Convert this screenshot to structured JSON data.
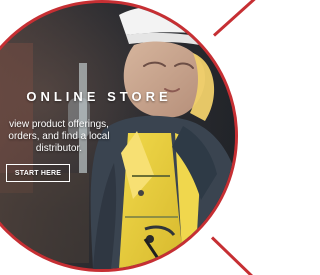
{
  "promo": {
    "title": "ONLINE STORE",
    "description": "view product offerings, orders, and find a local distributor.",
    "button_label": "START HERE"
  },
  "colors": {
    "accent_red": "#c62f33",
    "text_white": "#ffffff"
  },
  "icons": {
    "hero_image": "worker-photo"
  }
}
